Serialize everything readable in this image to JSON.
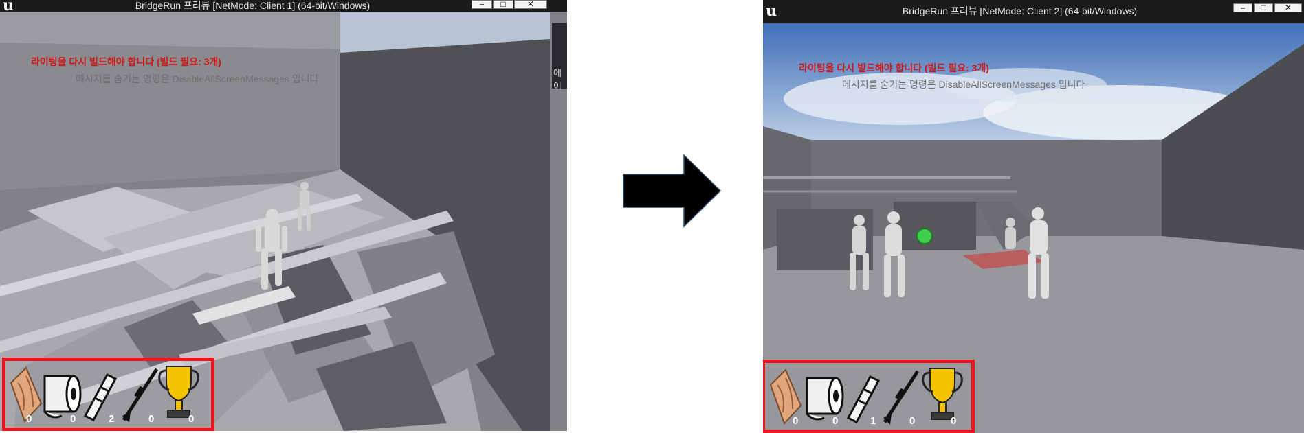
{
  "windows": [
    {
      "id": "client1",
      "title": "BridgeRun 프리뷰 [NetMode: Client 1]  (64-bit/Windows)",
      "controls": {
        "minimize": "–",
        "maximize": "□",
        "close": "✕"
      },
      "messages": {
        "warning": "라이팅을 다시 빌드해야 합니다 (빌드 필요: 3개)",
        "hint": "메시지를 숨기는 명령은 DisableAllScreenMessages 입니다"
      },
      "side_label": "에이",
      "hud": {
        "items": [
          {
            "icon": "wood-plank-icon",
            "count": "0"
          },
          {
            "icon": "toilet-paper-roll-icon",
            "count": "0"
          },
          {
            "icon": "telescope-icon",
            "count": "2"
          },
          {
            "icon": "sniper-rifle-icon",
            "count": "0"
          },
          {
            "icon": "trophy-icon",
            "count": "0"
          }
        ]
      }
    },
    {
      "id": "client2",
      "title": "BridgeRun 프리뷰 [NetMode: Client 2]  (64-bit/Windows)",
      "controls": {
        "minimize": "–",
        "maximize": "□",
        "close": "✕"
      },
      "messages": {
        "warning": "라이팅을 다시 빌드해야 합니다 (빌드 필요: 3개)",
        "hint": "메시지를 숨기는 명령은 DisableAllScreenMessages 입니다"
      },
      "hud": {
        "items": [
          {
            "icon": "wood-plank-icon",
            "count": "0"
          },
          {
            "icon": "toilet-paper-roll-icon",
            "count": "0"
          },
          {
            "icon": "telescope-icon",
            "count": "1"
          },
          {
            "icon": "sniper-rifle-icon",
            "count": "0"
          },
          {
            "icon": "trophy-icon",
            "count": "0"
          }
        ]
      }
    }
  ],
  "colors": {
    "hud_border": "#e8141e",
    "warning_text": "#d01818",
    "arrow": "#000000"
  }
}
